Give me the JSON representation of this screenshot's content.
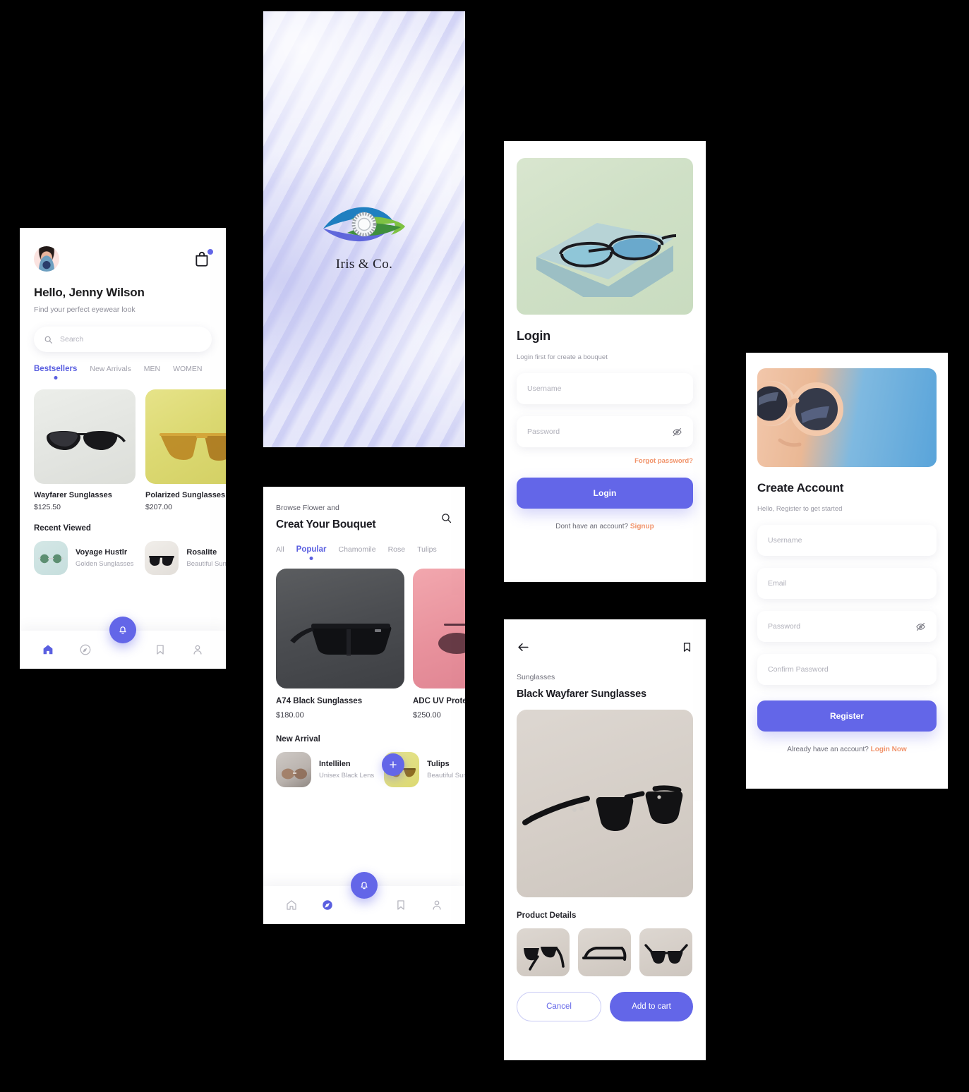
{
  "background_color": "#000000",
  "accent": {
    "purple": "#6366e8",
    "purple_text": "#5a5fe0",
    "orange": "#f1936a"
  },
  "home": {
    "name": "home-screen",
    "avatar_icon": "user-avatar",
    "cart_icon": "shopping-bag-icon",
    "greeting": "Hello, Jenny Wilson",
    "subtitle": "Find your perfect eyewear look",
    "search": {
      "placeholder": "Search",
      "icon": "search-icon"
    },
    "tabs": [
      {
        "label": "Bestsellers",
        "active": true
      },
      {
        "label": "New Arrivals",
        "active": false
      },
      {
        "label": "MEN",
        "active": false
      },
      {
        "label": "WOMEN",
        "active": false
      }
    ],
    "products": [
      {
        "title": "Wayfarer Sunglasses",
        "price": "$125.50",
        "image": "black-wayfarer-on-grey"
      },
      {
        "title": "Polarized Sunglasses",
        "price": "$207.00",
        "image": "gold-aviator-on-yellow"
      }
    ],
    "recent_title": "Recent Viewed",
    "recent": [
      {
        "name": "Voyage Hustlr",
        "desc": "Golden Sunglasses",
        "image": "round-green-lens-on-mint"
      },
      {
        "name": "Rosalite",
        "desc": "Beautiful Sunglasses",
        "image": "black-sunglasses-on-white"
      }
    ],
    "navbar": [
      {
        "icon": "home-icon",
        "active": true
      },
      {
        "icon": "compass-icon",
        "active": false
      },
      {
        "icon": "bell-icon",
        "active": false,
        "fab": true
      },
      {
        "icon": "bookmark-icon",
        "active": false
      },
      {
        "icon": "person-icon",
        "active": false
      }
    ]
  },
  "splash": {
    "name": "splash-screen",
    "logo_icon": "eye-logo-icon",
    "brand": "Iris & Co."
  },
  "browse": {
    "name": "browse-screen",
    "eyebrow": "Browse Flower and",
    "title": "Creat Your Bouquet",
    "search_icon": "search-icon",
    "categories": [
      {
        "label": "All",
        "active": false
      },
      {
        "label": "Popular",
        "active": true
      },
      {
        "label": "Chamomile",
        "active": false
      },
      {
        "label": "Rose",
        "active": false
      },
      {
        "label": "Tulips",
        "active": false
      }
    ],
    "products": [
      {
        "title": "A74 Black Sunglasses",
        "price": "$180.00",
        "image": "black-shield-sunglasses-dark-bg"
      },
      {
        "title": "ADC UV Protection",
        "price": "$250.00",
        "image": "sunglasses-on-pink-bg"
      }
    ],
    "add_button_icon": "plus-icon",
    "new_arrival_title": "New Arrival",
    "new_arrival": [
      {
        "name": "Intellilen",
        "desc": "Unisex Black Lens",
        "image": "two-pairs-grey"
      },
      {
        "name": "Tulips",
        "desc": "Beautiful Sunglasses",
        "image": "gold-sunglasses-yellow"
      }
    ],
    "navbar": [
      {
        "icon": "home-icon",
        "active": false
      },
      {
        "icon": "compass-icon",
        "active": true
      },
      {
        "icon": "bell-icon",
        "active": false,
        "fab": true
      },
      {
        "icon": "bookmark-icon",
        "active": false
      },
      {
        "icon": "person-icon",
        "active": false
      }
    ]
  },
  "login": {
    "name": "login-screen",
    "hero_image": "glasses-in-blue-box-on-green",
    "title": "Login",
    "subtitle": "Login first for create a bouquet",
    "fields": [
      {
        "placeholder": "Username",
        "name": "username-field",
        "icon": null
      },
      {
        "placeholder": "Password",
        "name": "password-field",
        "icon": "eye-off-icon"
      }
    ],
    "forgot_label": "Forgot password?",
    "submit_label": "Login",
    "footer_text": "Dont have an account? ",
    "footer_link": "Signup"
  },
  "detail": {
    "name": "product-detail-screen",
    "back_icon": "arrow-left-icon",
    "bookmark_icon": "bookmark-icon",
    "category": "Sunglasses",
    "title": "Black Wayfarer Sunglasses",
    "hero_image": "black-wayfarer-angled-beige",
    "details_title": "Product Details",
    "thumbnails": [
      {
        "image": "wayfarer-rear-view"
      },
      {
        "image": "wayfarer-side-view"
      },
      {
        "image": "wayfarer-front-view"
      }
    ],
    "cancel_label": "Cancel",
    "add_label": "Add to cart"
  },
  "register": {
    "name": "create-account-screen",
    "hero_image": "woman-wearing-sunglasses-blue-sky",
    "title": "Create Account",
    "subtitle": "Hello, Register to get started",
    "fields": [
      {
        "placeholder": "Username",
        "name": "username-field",
        "icon": null
      },
      {
        "placeholder": "Email",
        "name": "email-field",
        "icon": null
      },
      {
        "placeholder": "Password",
        "name": "password-field",
        "icon": "eye-off-icon"
      },
      {
        "placeholder": "Confirm Password",
        "name": "confirm-password-field",
        "icon": null
      }
    ],
    "submit_label": "Register",
    "footer_text": "Already have an account? ",
    "footer_link": "Login Now"
  }
}
